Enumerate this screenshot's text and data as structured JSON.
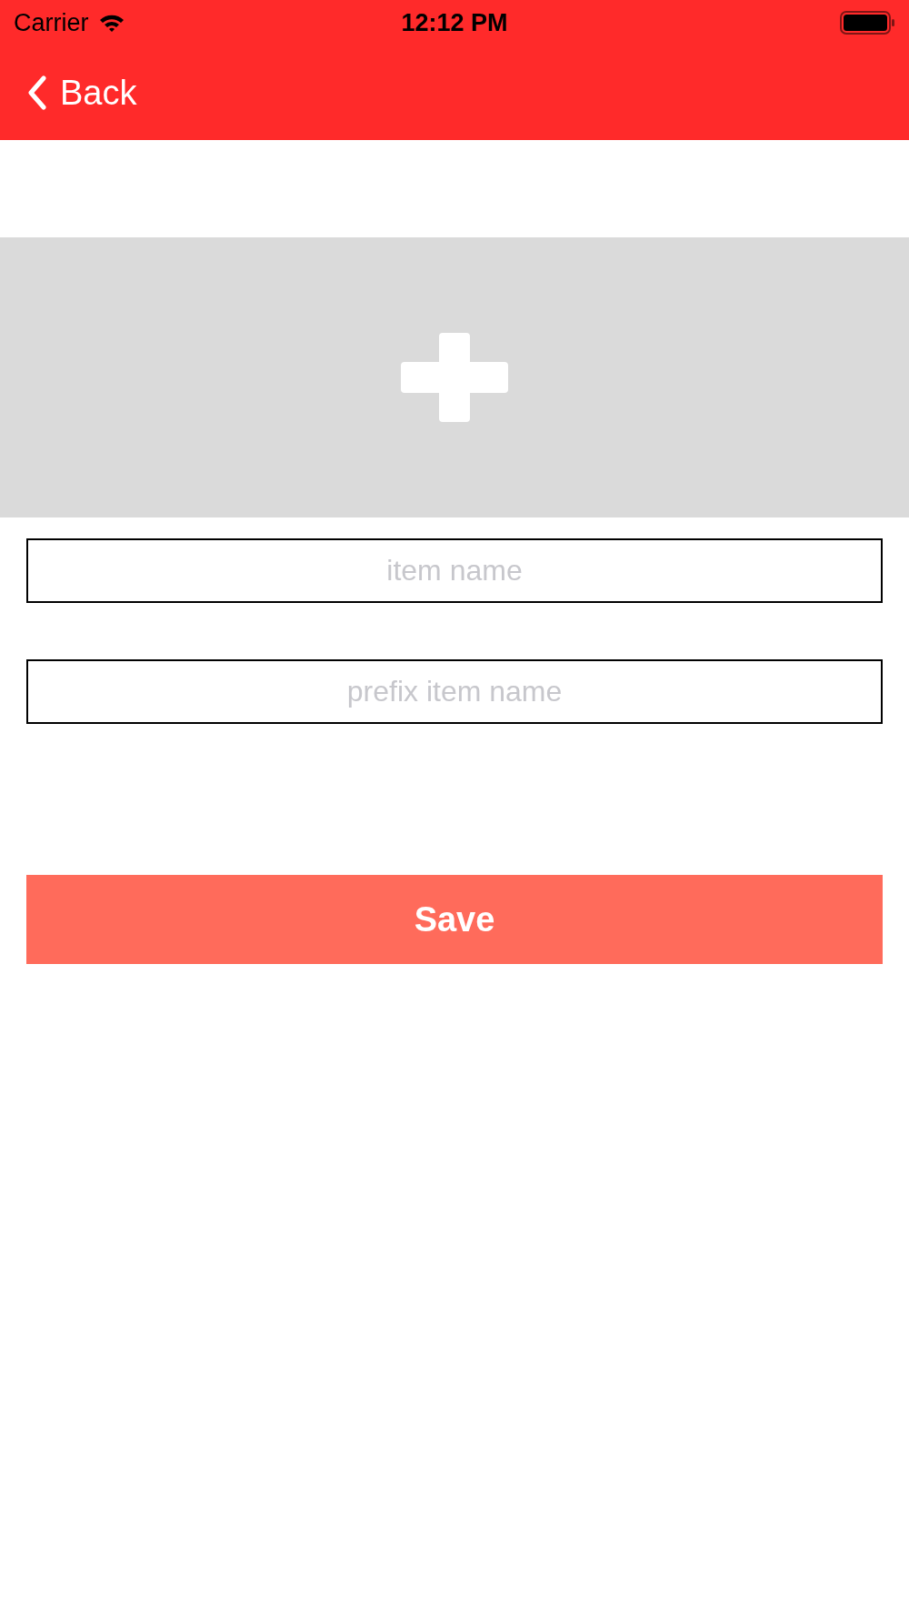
{
  "status_bar": {
    "carrier": "Carrier",
    "time": "12:12 PM"
  },
  "nav_bar": {
    "back_label": "Back"
  },
  "fields": [
    {
      "placeholder": "item name"
    },
    {
      "placeholder": "prefix item name"
    }
  ],
  "save_button": {
    "label": "Save"
  }
}
